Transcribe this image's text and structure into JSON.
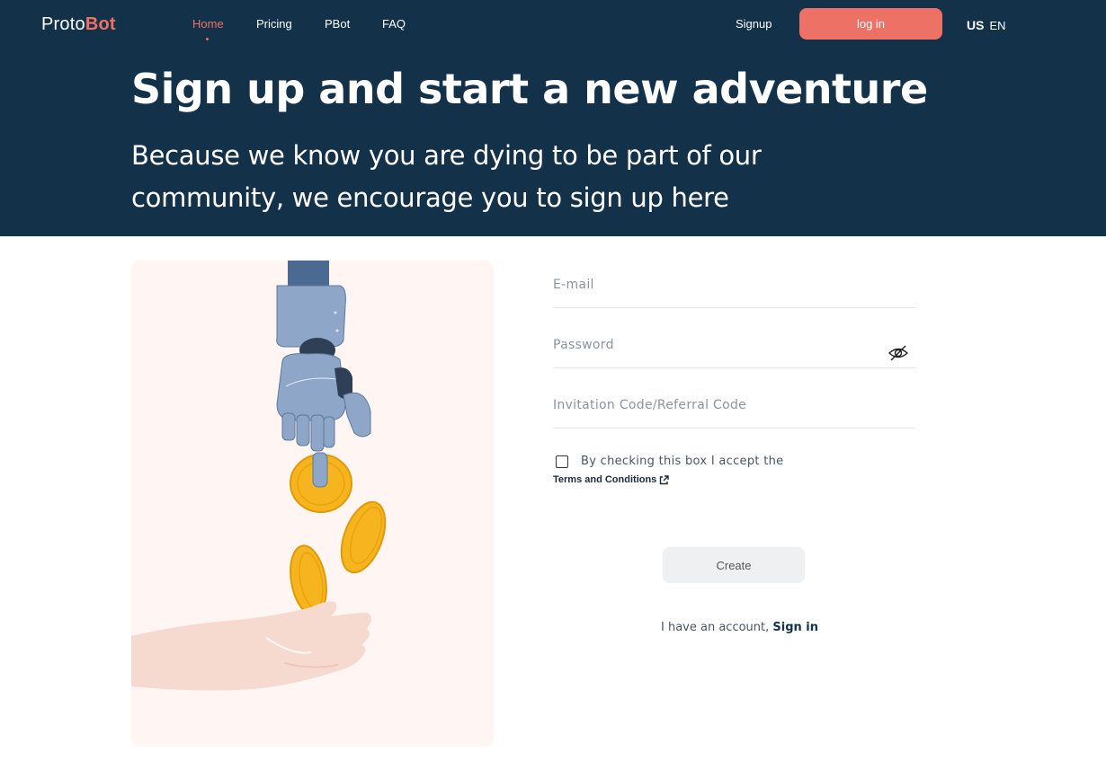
{
  "brand": {
    "prefix": "Proto",
    "accent": "Bot"
  },
  "nav": {
    "items": [
      {
        "label": "Home",
        "active": true
      },
      {
        "label": "Pricing",
        "active": false
      },
      {
        "label": "PBot",
        "active": false
      },
      {
        "label": "FAQ",
        "active": false
      }
    ],
    "signup_label": "Signup",
    "login_label": "log in",
    "language": {
      "flag": "US",
      "code": "EN"
    }
  },
  "hero": {
    "title": "Sign up and start a new adventure",
    "subtitle": "Because we know you are dying to be part of our community, we encourage you to sign up here"
  },
  "form": {
    "email_placeholder": "E-mail",
    "password_placeholder": "Password",
    "invite_placeholder": "Invitation Code/Referral Code",
    "terms_text": "By checking this box I accept the",
    "terms_link": "Terms and Conditions",
    "create_label": "Create",
    "account_text": "I have an account,",
    "signin_label": "Sign in"
  },
  "colors": {
    "header_bg": "#14314a",
    "accent": "#ee7166",
    "illustration_bg": "#fff5f3",
    "coin": "#f6b51e"
  }
}
